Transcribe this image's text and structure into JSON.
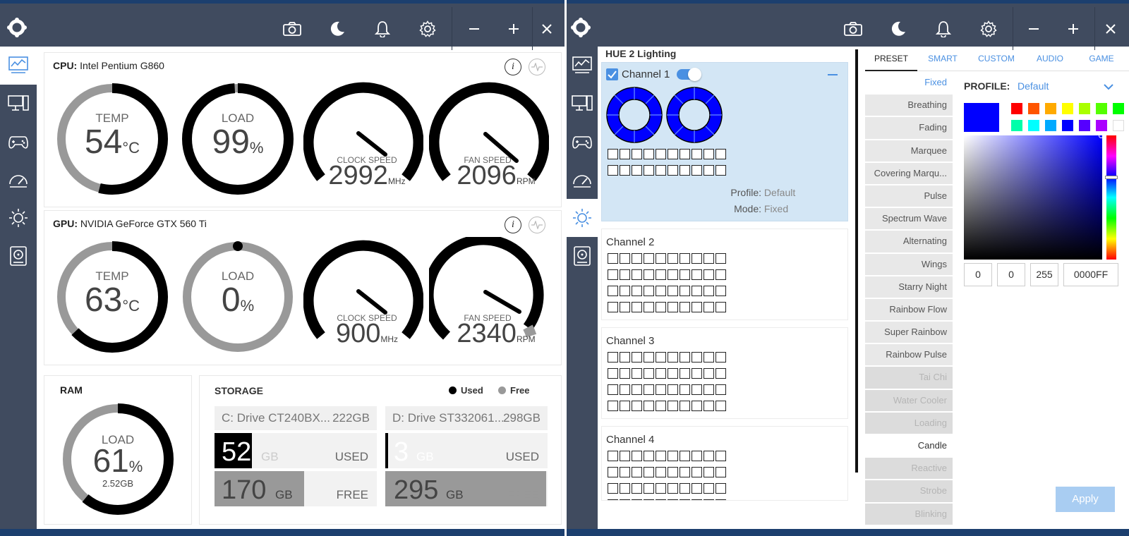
{
  "colors": {
    "titlebar": "#404b5f",
    "accent": "#4a90e2",
    "gaugeDark": "#000000",
    "gaugeLight": "#999999",
    "selectedColor": "#0000ff"
  },
  "left": {
    "toolbar_icons": [
      "camera-icon",
      "moon-icon",
      "bell-icon",
      "gear-icon",
      "minimize-icon",
      "plus-icon",
      "close-icon"
    ],
    "sidebar_icons": [
      "dashboard-icon",
      "pc-icon",
      "gamepad-icon",
      "speedometer-icon",
      "sun-icon",
      "disk-icon"
    ],
    "cpu": {
      "label": "CPU:",
      "name": "Intel Pentium G860",
      "temp": {
        "label": "TEMP",
        "value": "54",
        "unit": "°C",
        "fraction": 0.54
      },
      "load": {
        "label": "LOAD",
        "value": "99",
        "unit": "%",
        "fraction": 0.99
      },
      "clock": {
        "label": "CLOCK SPEED",
        "value": "2992",
        "unit": "MHz"
      },
      "fan": {
        "label": "FAN SPEED",
        "value": "2096",
        "unit": "RPM"
      }
    },
    "gpu": {
      "label": "GPU:",
      "name": "NVIDIA GeForce GTX 560 Ti",
      "temp": {
        "label": "TEMP",
        "value": "63",
        "unit": "°C",
        "fraction": 0.63
      },
      "load": {
        "label": "LOAD",
        "value": "0",
        "unit": "%",
        "fraction": 0.0
      },
      "clock": {
        "label": "CLOCK SPEED",
        "value": "900",
        "unit": "MHz"
      },
      "fan": {
        "label": "FAN SPEED",
        "value": "2340",
        "unit": "RPM"
      }
    },
    "ram": {
      "title": "RAM",
      "label": "LOAD",
      "value": "61",
      "unit": "%",
      "sub": "2.52GB",
      "fraction": 0.61
    },
    "storage": {
      "title": "STORAGE",
      "legend_used": "Used",
      "legend_free": "Free",
      "drives": [
        {
          "name": "C: Drive CT240BX...",
          "size": "222GB",
          "used": "52",
          "used_unit": "GB",
          "used_label": "USED",
          "free": "170",
          "free_unit": "GB",
          "free_label": "FREE",
          "used_fraction": 0.23
        },
        {
          "name": "D: Drive ST332061...",
          "size": "298GB",
          "used": "3",
          "used_unit": "GB",
          "used_label": "USED",
          "free": "295",
          "free_unit": "GB",
          "free_label": "FREE",
          "used_fraction": 0.01
        }
      ]
    }
  },
  "right": {
    "title": "HUE 2 Lighting",
    "channels": [
      {
        "name": "Channel 1",
        "profile_label": "Profile:",
        "profile": "Default",
        "mode_label": "Mode:",
        "mode": "Fixed"
      },
      {
        "name": "Channel 2"
      },
      {
        "name": "Channel 3"
      },
      {
        "name": "Channel 4"
      }
    ],
    "tabs": [
      "PRESET",
      "SMART",
      "CUSTOM",
      "AUDIO",
      "GAME"
    ],
    "presets": [
      {
        "label": "Fixed",
        "state": "selected"
      },
      {
        "label": "Breathing",
        "state": "normal"
      },
      {
        "label": "Fading",
        "state": "normal"
      },
      {
        "label": "Marquee",
        "state": "normal"
      },
      {
        "label": "Covering Marqu...",
        "state": "normal"
      },
      {
        "label": "Pulse",
        "state": "normal"
      },
      {
        "label": "Spectrum Wave",
        "state": "normal"
      },
      {
        "label": "Alternating",
        "state": "normal"
      },
      {
        "label": "Wings",
        "state": "normal"
      },
      {
        "label": "Starry Night",
        "state": "normal"
      },
      {
        "label": "Rainbow Flow",
        "state": "normal"
      },
      {
        "label": "Super Rainbow",
        "state": "normal"
      },
      {
        "label": "Rainbow Pulse",
        "state": "normal"
      },
      {
        "label": "Tai Chi",
        "state": "disabled"
      },
      {
        "label": "Water Cooler",
        "state": "disabled"
      },
      {
        "label": "Loading",
        "state": "disabled"
      },
      {
        "label": "Candle",
        "state": "white"
      },
      {
        "label": "Reactive",
        "state": "disabled"
      },
      {
        "label": "Strobe",
        "state": "disabled"
      },
      {
        "label": "Blinking",
        "state": "disabled"
      }
    ],
    "profile_label": "PROFILE:",
    "profile_value": "Default",
    "swatches": [
      "#ff0000",
      "#ff5500",
      "#ffaa00",
      "#ffff00",
      "#aaff00",
      "#55ff00",
      "#00ff00",
      "#00ffaa",
      "#00ffff",
      "#00aaff",
      "#0000ff",
      "#5500ff",
      "#aa00ff",
      "#ffffff"
    ],
    "rgb": {
      "r": "0",
      "g": "0",
      "b": "255",
      "hex": "0000FF"
    },
    "apply_label": "Apply"
  }
}
